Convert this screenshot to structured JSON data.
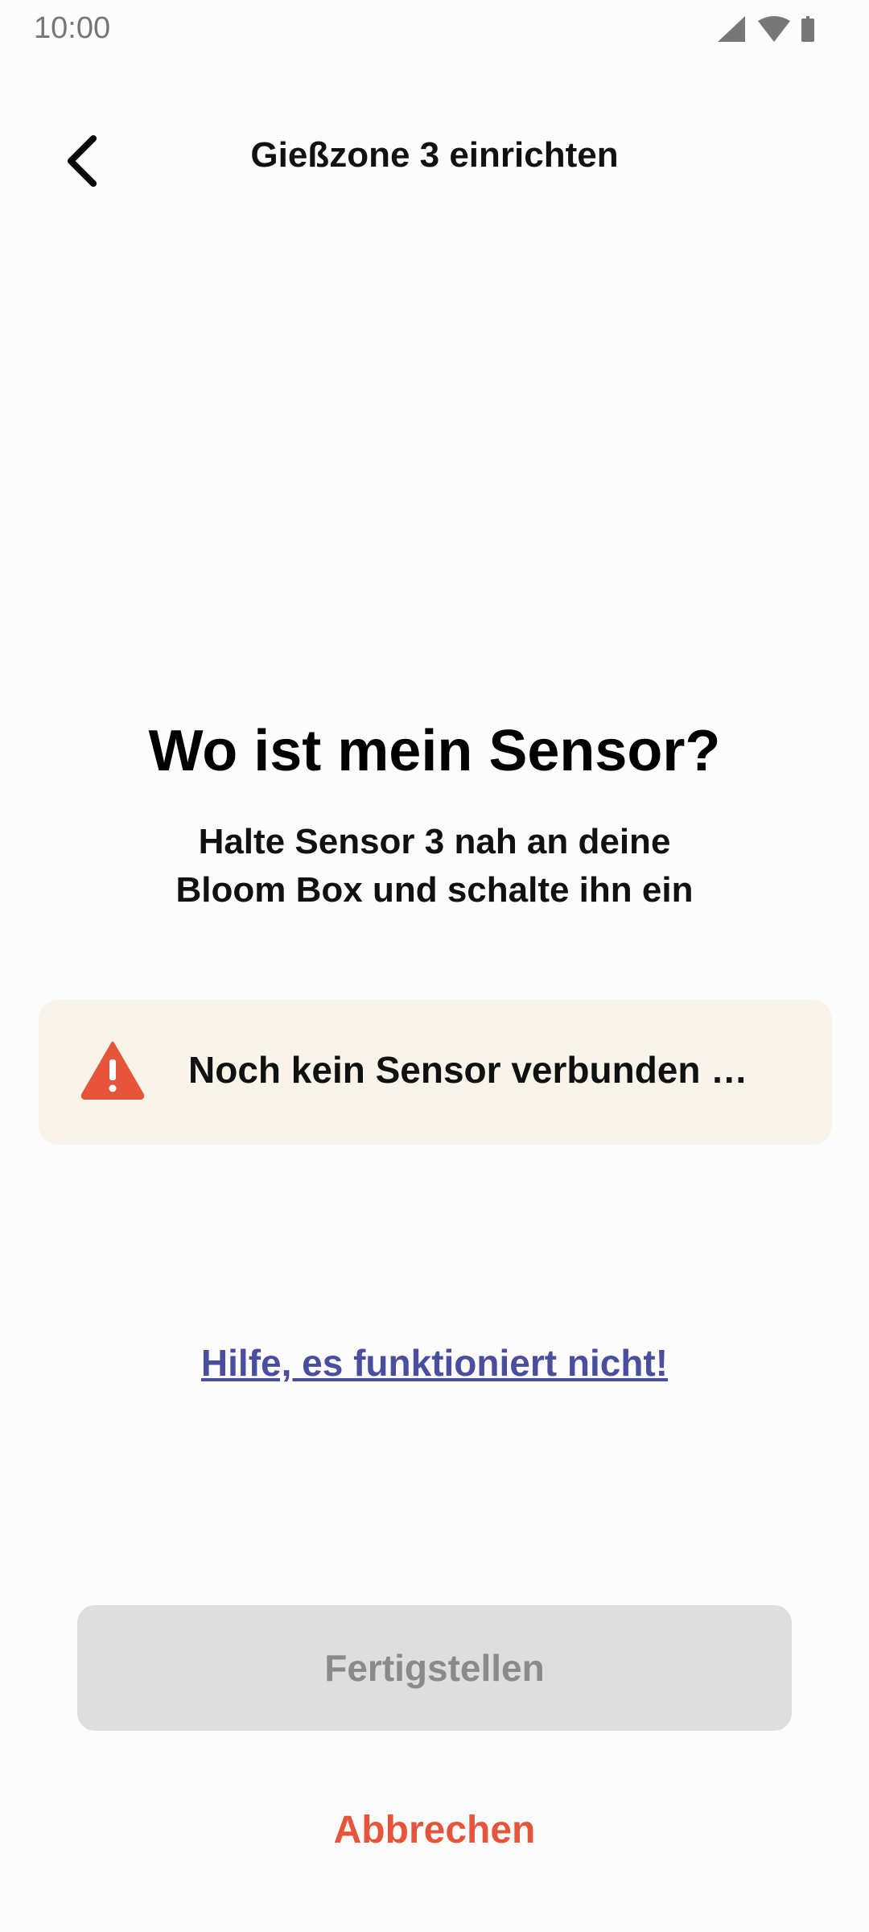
{
  "status_bar": {
    "time": "10:00",
    "icons": [
      "signal-icon",
      "wifi-icon",
      "battery-icon"
    ]
  },
  "header": {
    "back_icon": "chevron-left-icon",
    "title": "Gießzone 3 einrichten"
  },
  "main": {
    "headline": "Wo ist mein Sensor?",
    "instruction_line1": "Halte Sensor 3 nah an deine",
    "instruction_line2": "Bloom Box und schalte ihn ein"
  },
  "alert": {
    "icon": "warning-icon",
    "text": "Noch kein Sensor verbunden …",
    "background": "#f8f4ea",
    "icon_color": "#e6553b"
  },
  "help_link": {
    "label": "Hilfe, es funktioniert nicht!",
    "color": "#4a4e9e"
  },
  "actions": {
    "finish_label": "Fertigstellen",
    "finish_disabled": true,
    "cancel_label": "Abbrechen",
    "cancel_color": "#e6553b"
  }
}
